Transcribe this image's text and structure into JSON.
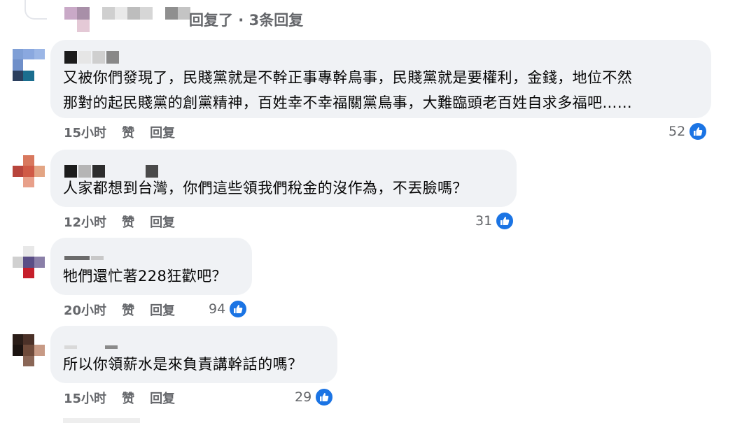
{
  "replies_header": {
    "text": "回复了 · 3条回复"
  },
  "comments": [
    {
      "lines": [
        "又被你們發現了，民賤黨就是不幹正事專幹鳥事，民賤黨就是要權利，金錢，地位不然",
        "那對的起民賤黨的創黨精神，百姓幸不幸福關黨鳥事，大難臨頭老百姓自求多福吧……"
      ],
      "time": "15小时",
      "like_label": "赞",
      "reply_label": "回复",
      "reactions": "52"
    },
    {
      "lines": [
        "人家都想到台灣，你們這些領我們稅金的沒作為，不丟臉嗎？"
      ],
      "time": "12小时",
      "like_label": "赞",
      "reply_label": "回复",
      "reactions": "31"
    },
    {
      "lines": [
        "牠們還忙著228狂歡吧？"
      ],
      "time": "20小时",
      "like_label": "赞",
      "reply_label": "回复",
      "reactions": "94"
    },
    {
      "lines": [
        "所以你領薪水是來負責講幹話的嗎？"
      ],
      "time": "15小时",
      "like_label": "赞",
      "reply_label": "回复",
      "reactions": "29"
    }
  ],
  "colors": {
    "bubble": "#f0f2f5",
    "meta_text": "#65676b",
    "like_blue": "#1b74e4"
  },
  "icons": {
    "reaction": "thumbs-up-icon"
  }
}
